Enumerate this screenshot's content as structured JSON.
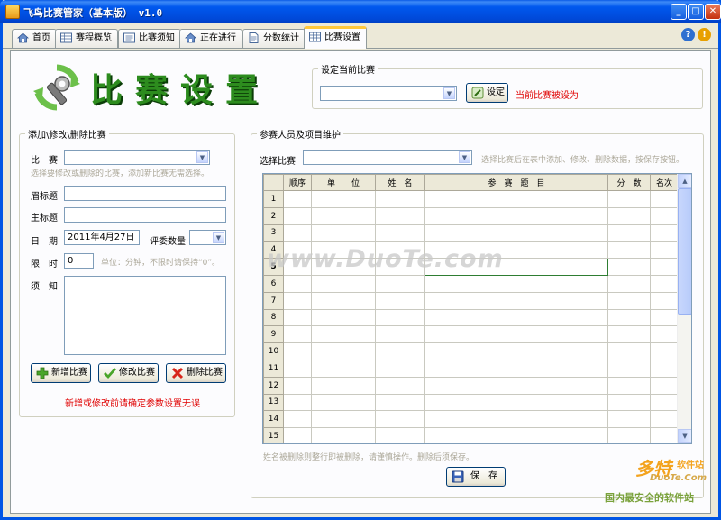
{
  "window": {
    "title": "飞鸟比赛管家（基本版） v1.0"
  },
  "tabs": [
    {
      "label": "首页"
    },
    {
      "label": "赛程概览"
    },
    {
      "label": "比赛须知"
    },
    {
      "label": "正在进行"
    },
    {
      "label": "分数统计"
    },
    {
      "label": "比赛设置"
    }
  ],
  "banner": {
    "title": "比赛设置"
  },
  "current_match": {
    "legend": "设定当前比赛",
    "select_value": "",
    "set_button": "设定",
    "status": "当前比赛被设为"
  },
  "edit_match": {
    "legend": "添加\\修改\\删除比赛",
    "match_label": "比　赛",
    "match_value": "",
    "match_hint": "选择要修改或删除的比赛，添加新比赛无需选择。",
    "subtitle_label": "眉标题",
    "subtitle_value": "",
    "main_title_label": "主标题",
    "main_title_value": "",
    "date_label": "日　期",
    "date_value": "2011年4月27日",
    "judges_label": "评委数量",
    "judges_value": "",
    "time_label": "限　时",
    "time_value": "0",
    "time_hint": "单位：分钟，不限时请保持“0”。",
    "notice_label": "须　知",
    "notice_value": "",
    "add_button": "新增比赛",
    "modify_button": "修改比赛",
    "delete_button": "删除比赛",
    "warning": "新增或修改前请确定参数设置无误"
  },
  "participants": {
    "legend": "参赛人员及项目维护",
    "select_label": "选择比赛",
    "select_value": "",
    "select_hint": "选择比赛后在表中添加、修改、删除数据，按保存按钮。",
    "columns": [
      "顺序",
      "单　　位",
      "姓　名",
      "参　赛　题　目",
      "分　数",
      "名次"
    ],
    "row_numbers": [
      "1",
      "2",
      "3",
      "4",
      "5",
      "6",
      "7",
      "8",
      "9",
      "10",
      "11",
      "12",
      "13",
      "14",
      "15"
    ],
    "delete_hint": "姓名被删除则整行即被删除，请谨慎操作。删除后须保存。",
    "save_button": "保　存"
  },
  "watermarks": {
    "main": "www.DuoTe.com",
    "logo_big": "多特",
    "logo_sub": "软件站",
    "logo_small": "DuoTe.Com",
    "logo_bottom": "国内最安全的软件站"
  },
  "colors": {
    "titlebar": "#0058ee",
    "banner_text": "#2d8c1e",
    "warning": "#e00000",
    "active_tab_accent": "#ffc83c"
  }
}
